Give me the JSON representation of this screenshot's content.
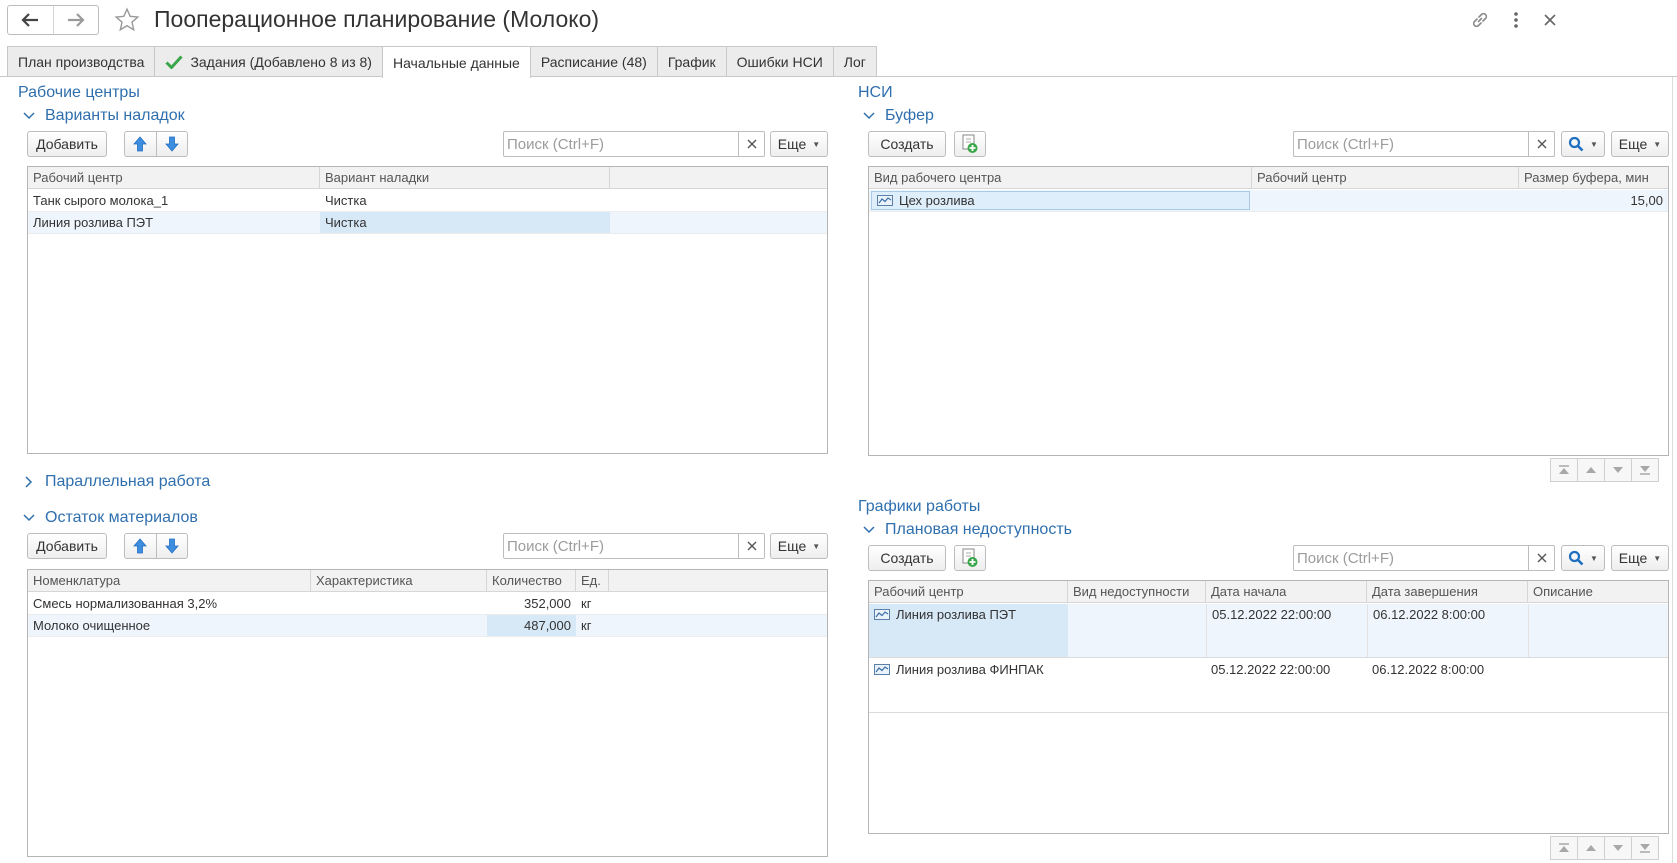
{
  "window": {
    "title": "Пооперационное планирование (Молоко)"
  },
  "tabs": [
    {
      "label": "План производства"
    },
    {
      "label": "Задания (Добавлено 8 из 8)"
    },
    {
      "label": "Начальные данные"
    },
    {
      "label": "Расписание (48)"
    },
    {
      "label": "График"
    },
    {
      "label": "Ошибки НСИ"
    },
    {
      "label": "Лог"
    }
  ],
  "left": {
    "group_title": "Рабочие центры",
    "setups": {
      "title": "Варианты наладок",
      "add_label": "Добавить",
      "search_placeholder": "Поиск (Ctrl+F)",
      "more_label": "Еще",
      "columns": [
        "Рабочий центр",
        "Вариант наладки"
      ],
      "rows": [
        {
          "work_center": "Танк сырого молока_1",
          "setup": "Чистка"
        },
        {
          "work_center": "Линия розлива ПЭТ",
          "setup": "Чистка"
        }
      ]
    },
    "parallel": {
      "title": "Параллельная работа"
    },
    "materials": {
      "title": "Остаток материалов",
      "add_label": "Добавить",
      "search_placeholder": "Поиск (Ctrl+F)",
      "more_label": "Еще",
      "columns": [
        "Номенклатура",
        "Характеристика",
        "Количество",
        "Ед."
      ],
      "rows": [
        {
          "item": "Смесь нормализованная 3,2%",
          "characteristic": "",
          "quantity": "352,000",
          "unit": "кг"
        },
        {
          "item": "Молоко очищенное",
          "characteristic": "",
          "quantity": "487,000",
          "unit": "кг"
        }
      ]
    }
  },
  "right": {
    "group_title": "НСИ",
    "buffer": {
      "title": "Буфер",
      "create_label": "Создать",
      "search_placeholder": "Поиск (Ctrl+F)",
      "more_label": "Еще",
      "columns": [
        "Вид рабочего центра",
        "Рабочий центр",
        "Размер буфера, мин"
      ],
      "rows": [
        {
          "kind": "Цех розлива",
          "work_center": "",
          "size": "15,00"
        }
      ]
    },
    "schedules": {
      "group_title": "Графики работы",
      "title": "Плановая недоступность",
      "create_label": "Создать",
      "search_placeholder": "Поиск (Ctrl+F)",
      "more_label": "Еще",
      "columns": [
        "Рабочий центр",
        "Вид недоступности",
        "Дата начала",
        "Дата завершения",
        "Описание"
      ],
      "rows": [
        {
          "work_center": "Линия розлива ПЭТ",
          "kind": "",
          "start": "05.12.2022 22:00:00",
          "end": "06.12.2022 8:00:00",
          "description": ""
        },
        {
          "work_center": "Линия розлива ФИНПАК",
          "kind": "",
          "start": "05.12.2022 22:00:00",
          "end": "06.12.2022 8:00:00",
          "description": ""
        }
      ]
    }
  },
  "colors": {
    "accent": "#2f6fae",
    "selected_row": "#eef5fc",
    "focused_cell": "#d7e8f7",
    "check": "#3aa64a"
  },
  "icons": [
    "back-arrow-icon",
    "forward-arrow-icon",
    "star-icon",
    "link-icon",
    "more-vertical-icon",
    "close-icon",
    "check-icon",
    "chevron-down-icon",
    "chevron-right-icon",
    "arrow-up-icon",
    "arrow-down-icon",
    "clear-icon",
    "search-icon",
    "copy-add-icon",
    "work-center-icon",
    "scroll-first-icon",
    "scroll-up-icon",
    "scroll-down-icon",
    "scroll-last-icon"
  ]
}
